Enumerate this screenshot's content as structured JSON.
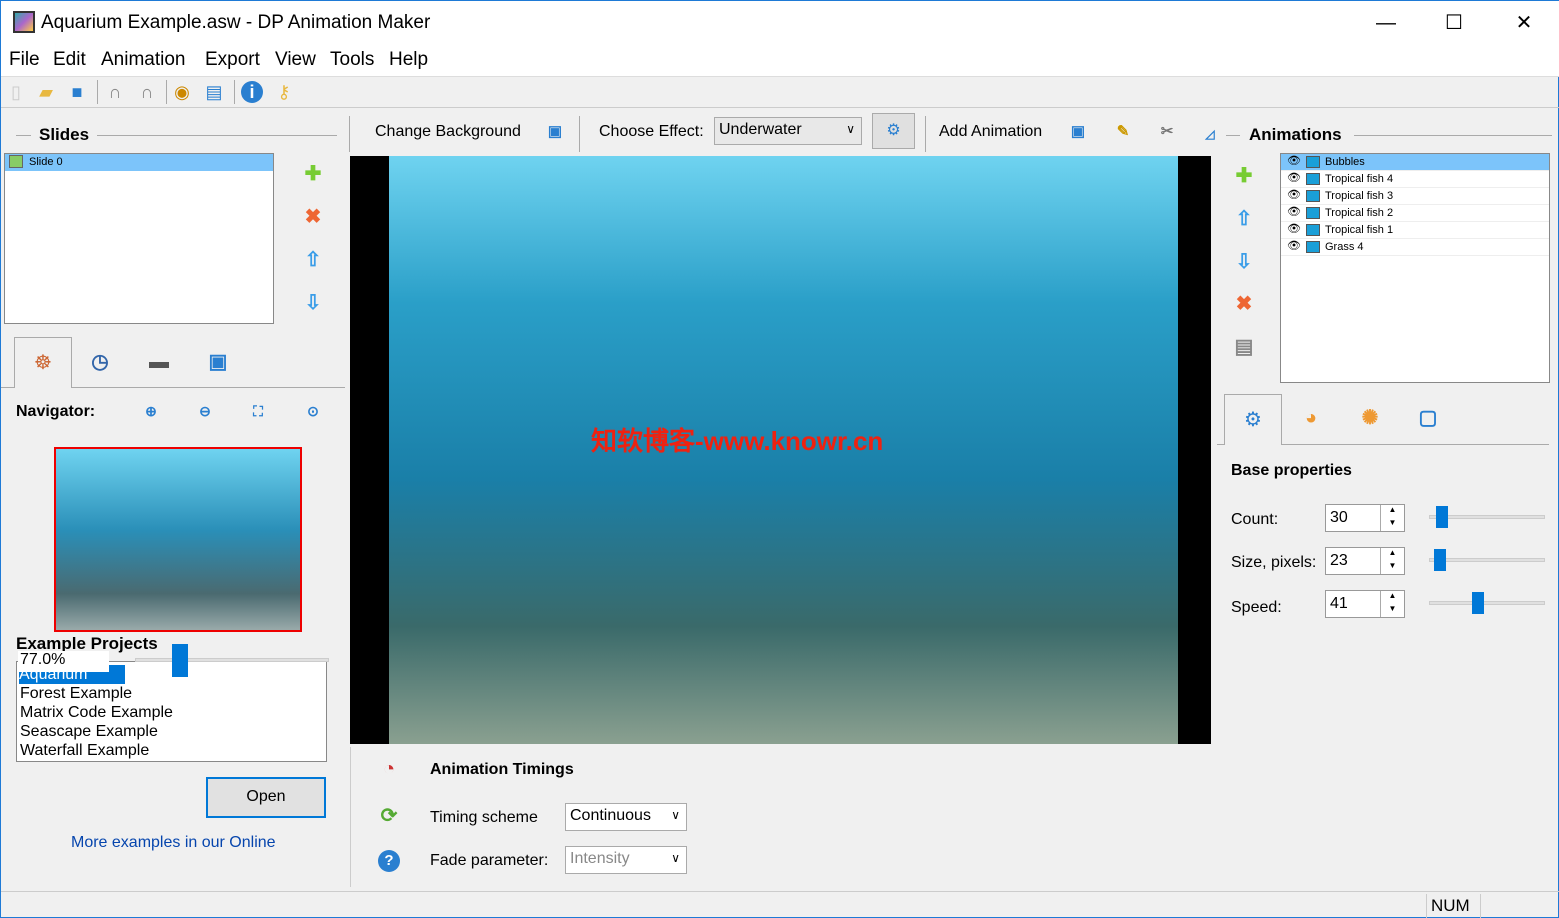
{
  "window": {
    "title": "Aquarium Example.asw - DP Animation Maker",
    "minimize": "—",
    "maximize": "☐",
    "close": "✕"
  },
  "menu": [
    "File",
    "Edit",
    "Animation",
    "Export",
    "View",
    "Tools",
    "Help"
  ],
  "toolbar": [
    "new-icon",
    "open-icon",
    "save-icon",
    "undo-icon",
    "redo-icon",
    "preview-icon",
    "export-video-icon",
    "info-icon",
    "key-icon"
  ],
  "slides": {
    "title": "Slides",
    "items": [
      {
        "label": "Slide 0",
        "selected": true
      }
    ]
  },
  "navigator": {
    "label": "Navigator:",
    "zoom": "77.0%",
    "zoom_level": 0.77
  },
  "examples": {
    "title": "Example Projects",
    "items": [
      "Aquarium Example",
      "Forest Example",
      "Matrix Code Example",
      "Seascape Example",
      "Waterfall Example"
    ],
    "selected": "Aquarium Example",
    "open": "Open",
    "link": "More examples in our Online"
  },
  "center_toolbar": {
    "change_background": "Change Background",
    "choose_effect": "Choose Effect:",
    "effect": "Underwater",
    "add_animation": "Add Animation"
  },
  "watermark": "知软博客-www.knowr.cn",
  "timings": {
    "title": "Animation Timings",
    "timing_scheme_label": "Timing scheme",
    "timing_scheme": "Continuous",
    "fade_label": "Fade parameter:",
    "fade": "Intensity"
  },
  "animations": {
    "title": "Animations",
    "items": [
      {
        "label": "Bubbles",
        "selected": true
      },
      {
        "label": "Tropical fish 4"
      },
      {
        "label": "Tropical fish 3"
      },
      {
        "label": "Tropical fish 2"
      },
      {
        "label": "Tropical fish 1"
      },
      {
        "label": "Grass 4"
      }
    ]
  },
  "base": {
    "title": "Base properties",
    "count_label": "Count:",
    "count": "30",
    "size_label": "Size, pixels:",
    "size": "23",
    "speed_label": "Speed:",
    "speed": "41"
  },
  "status": {
    "num": "NUM"
  }
}
